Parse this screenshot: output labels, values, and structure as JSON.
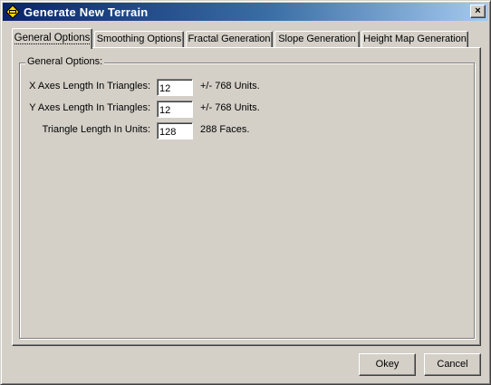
{
  "window": {
    "title": "Generate New Terrain",
    "close_glyph": "×",
    "icon": "terrain-app-icon"
  },
  "tabs": [
    {
      "label": "General Options",
      "accel": "G",
      "active": true
    },
    {
      "label": "Smoothing Options",
      "accel": "S",
      "active": false
    },
    {
      "label": "Fractal Generation",
      "accel": "F",
      "active": false
    },
    {
      "label": "Slope Generation",
      "accel": "l",
      "active": false
    },
    {
      "label": "Height Map Generation",
      "accel": "H",
      "active": false
    }
  ],
  "group": {
    "label": "General Options:"
  },
  "fields": [
    {
      "label": "X Axes Length In Triangles:",
      "value": "12",
      "note": "+/- 768 Units."
    },
    {
      "label": "Y Axes Length In Triangles:",
      "value": "12",
      "note": "+/- 768 Units."
    },
    {
      "label": "Triangle Length In Units:",
      "value": "128",
      "note": "288 Faces."
    }
  ],
  "buttons": {
    "ok_label": "Okey",
    "cancel_label": "Cancel"
  },
  "colors": {
    "face": "#d4d0c8",
    "title_start": "#0a246a",
    "title_end": "#a6caf0"
  }
}
